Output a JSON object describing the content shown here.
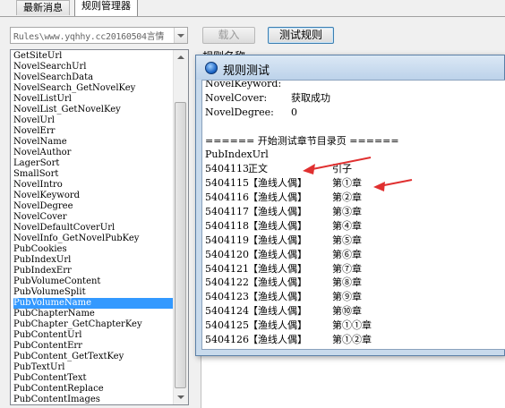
{
  "tabs": [
    {
      "label": "最新消息",
      "active": false
    },
    {
      "label": "规则管理器",
      "active": true
    }
  ],
  "toolbar": {
    "rule_file": "Rules\\www.yqhhy.cc20160504言情",
    "load_button": "载入",
    "test_button": "测试规则",
    "partial_label": "规则名称"
  },
  "rule_items": [
    "GetSiteUrl",
    "NovelSearchUrl",
    "NovelSearchData",
    "NovelSearch_GetNovelKey",
    "NovelListUrl",
    "NovelList_GetNovelKey",
    "NovelUrl",
    "NovelErr",
    "NovelName",
    "NovelAuthor",
    "LagerSort",
    "SmallSort",
    "NovelIntro",
    "NovelKeyword",
    "NovelDegree",
    "NovelCover",
    "NovelDefaultCoverUrl",
    "NovelInfo_GetNovelPubKey",
    "PubCookies",
    "PubIndexUrl",
    "PubIndexErr",
    "PubVolumeContent",
    "PubVolumeSplit",
    "PubVolumeName",
    "PubChapterName",
    "PubChapter_GetChapterKey",
    "PubContentUrl",
    "PubContentErr",
    "PubContent_GetTextKey",
    "PubTextUrl",
    "PubContentText",
    "PubContentReplace",
    "PubContentImages"
  ],
  "selected_rule": "PubVolumeName",
  "dialog": {
    "title": "规则测试",
    "fields": [
      {
        "key": "NovelKeyword:",
        "value": ""
      },
      {
        "key": "NovelCover:",
        "value": "获取成功"
      },
      {
        "key": "NovelDegree:",
        "value": "0"
      }
    ],
    "section_header": "====== 开始测试章节目录页 ======",
    "pub_index_label": "PubIndexUrl",
    "chapters": [
      {
        "id": "5404113",
        "volume": "正文",
        "chapter": "引子"
      },
      {
        "id": "5404115",
        "volume": "【渔线人偶】",
        "chapter": "第①章"
      },
      {
        "id": "5404116",
        "volume": "【渔线人偶】",
        "chapter": "第②章"
      },
      {
        "id": "5404117",
        "volume": "【渔线人偶】",
        "chapter": "第③章"
      },
      {
        "id": "5404118",
        "volume": "【渔线人偶】",
        "chapter": "第④章"
      },
      {
        "id": "5404119",
        "volume": "【渔线人偶】",
        "chapter": "第⑤章"
      },
      {
        "id": "5404120",
        "volume": "【渔线人偶】",
        "chapter": "第⑥章"
      },
      {
        "id": "5404121",
        "volume": "【渔线人偶】",
        "chapter": "第⑦章"
      },
      {
        "id": "5404122",
        "volume": "【渔线人偶】",
        "chapter": "第⑧章"
      },
      {
        "id": "5404123",
        "volume": "【渔线人偶】",
        "chapter": "第⑨章"
      },
      {
        "id": "5404124",
        "volume": "【渔线人偶】",
        "chapter": "第⑩章"
      },
      {
        "id": "5404125",
        "volume": "【渔线人偶】",
        "chapter": "第①①章"
      },
      {
        "id": "5404126",
        "volume": "【渔线人偶】",
        "chapter": "第①②章"
      }
    ]
  },
  "colors": {
    "selection": "#3399ff",
    "annotation_arrow": "#e03030",
    "dialog_frame": "#c8daec"
  }
}
